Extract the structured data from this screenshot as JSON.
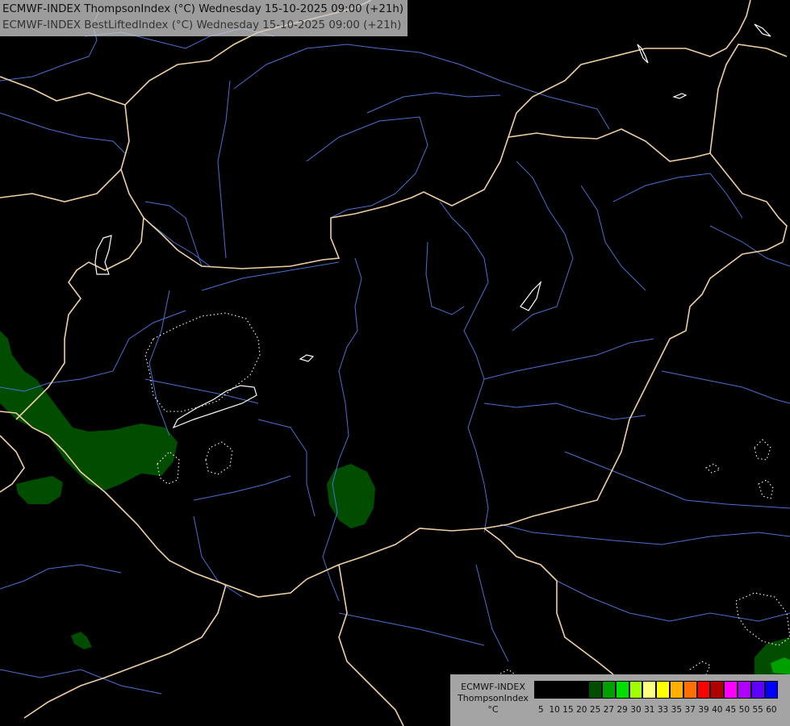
{
  "titles": {
    "line1": "ECMWF-INDEX ThompsonIndex (°C) Wednesday 15-10-2025 09:00 (+21h)",
    "line2": "ECMWF-INDEX BestLiftedIndex (°C) Wednesday 15-10-2025 09:00 (+21h)"
  },
  "legend": {
    "model": "ECMWF-INDEX",
    "parameter": "ThompsonIndex",
    "unit": "°C",
    "ticks": [
      "5",
      "10",
      "15",
      "20",
      "25",
      "27",
      "29",
      "30",
      "31",
      "33",
      "35",
      "37",
      "39",
      "40",
      "45",
      "50",
      "55",
      "60"
    ],
    "colors": [
      "#000000",
      "#000000",
      "#000000",
      "#000000",
      "#004d00",
      "#00a000",
      "#00e000",
      "#a0ff00",
      "#ffff80",
      "#ffff00",
      "#ffb000",
      "#ff7000",
      "#ff0000",
      "#b00000",
      "#ff00ff",
      "#b000ff",
      "#6000ff",
      "#0000ff"
    ]
  },
  "map_colors": {
    "background": "#000000",
    "border": "#f0d0a0",
    "river": "#4a6fd0",
    "contour": "#ffffff",
    "fill_dark": "#004d00",
    "fill_mid": "#00a000"
  }
}
